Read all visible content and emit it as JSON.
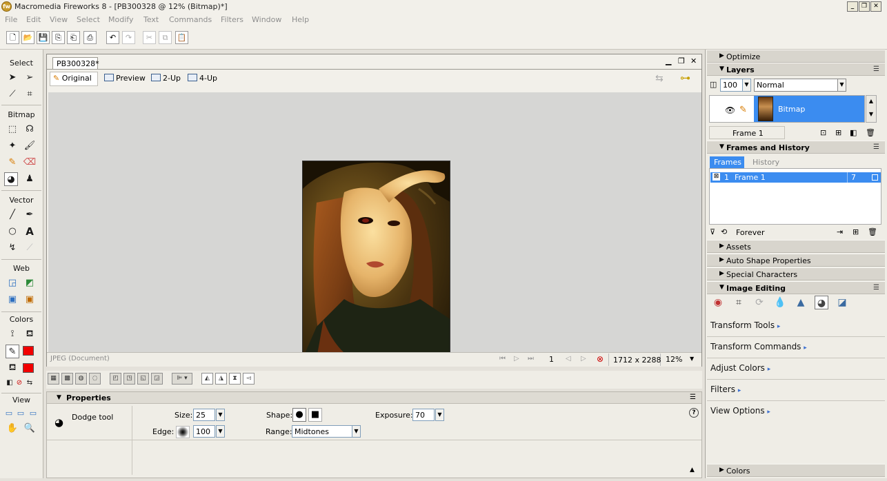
{
  "app": {
    "title": "Macromedia Fireworks 8 - [PB300328 @ 12% (Bitmap)*]",
    "icon_letter": "fw",
    "minimize_glyph": "_",
    "restore_glyph": "❐",
    "close_glyph": "✕"
  },
  "menu": [
    "File",
    "Edit",
    "View",
    "Select",
    "Modify",
    "Text",
    "Commands",
    "Filters",
    "Window",
    "Help"
  ],
  "toolbar_icons": [
    "new-icon",
    "open-icon",
    "save-icon",
    "import-icon",
    "export-icon",
    "print-icon",
    "undo-icon",
    "redo-icon",
    "cut-icon",
    "copy-icon",
    "paste-icon"
  ],
  "tools": {
    "select": "Select",
    "bitmap": "Bitmap",
    "vector": "Vector",
    "web": "Web",
    "colors": "Colors",
    "view": "View",
    "text_tool_glyph": "A",
    "stroke_color": "#f20000",
    "fill_color": "#f20000"
  },
  "document": {
    "tab": "PB300328*",
    "view_tabs": [
      "Original",
      "Preview",
      "2-Up",
      "4-Up"
    ],
    "status_type": "JPEG (Document)",
    "frame_number": "1",
    "dimensions": "1712 x 2288",
    "zoom": "12%"
  },
  "properties": {
    "header": "Properties",
    "tool_name": "Dodge tool",
    "size_label": "Size:",
    "size_value": "25",
    "edge_label": "Edge:",
    "edge_value": "100",
    "shape_label": "Shape:",
    "range_label": "Range:",
    "range_value": "Midtones",
    "exposure_label": "Exposure:",
    "exposure_value": "70",
    "help_glyph": "?"
  },
  "panels": {
    "optimize": "Optimize",
    "layers": {
      "title": "Layers",
      "opacity": "100",
      "blend_mode": "Normal",
      "layer_name": "Bitmap",
      "frame_select": "Frame 1"
    },
    "frames_history": {
      "title": "Frames and History",
      "tabs": [
        "Frames",
        "History"
      ],
      "frame_index": "1",
      "frame_name": "Frame 1",
      "frame_delay": "7",
      "loop": "Forever"
    },
    "assets": "Assets",
    "auto_shape": "Auto Shape Properties",
    "special_chars": "Special Characters",
    "image_editing": {
      "title": "Image Editing",
      "categories": [
        "Transform Tools",
        "Transform Commands",
        "Adjust Colors",
        "Filters",
        "View Options"
      ]
    },
    "colors": "Colors"
  },
  "accent": "#3b8cf0"
}
